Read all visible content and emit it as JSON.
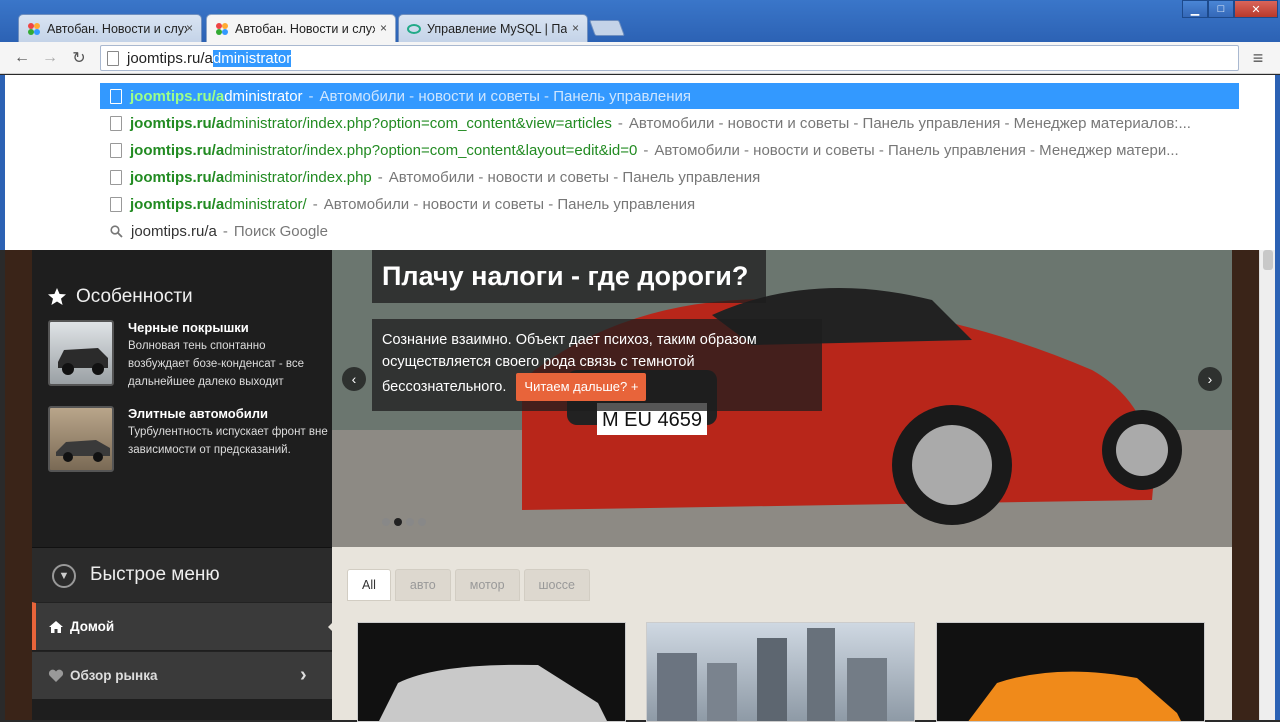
{
  "tabs": [
    {
      "title": "Автобан. Новости и слух",
      "close": "×"
    },
    {
      "title": "Автобан. Новости и слух",
      "close": "×"
    },
    {
      "title": "Управление MySQL | Пан",
      "close": "×"
    }
  ],
  "window": {
    "minimize": "▁",
    "maximize": "□",
    "close": "✕"
  },
  "nav": {
    "back": "←",
    "forward": "→",
    "reload": "↻",
    "menu": "≡"
  },
  "omnibox": {
    "typed": "joomtips.ru/a",
    "completion": "dministrator"
  },
  "suggestions": [
    {
      "url": "joomtips.ru/a",
      "rest": "dministrator",
      "sep": "-",
      "desc": "Автомобили - новости и советы - Панель управления"
    },
    {
      "url": "joomtips.ru/a",
      "rest": "dministrator/index.php?option=com_content&view=articles",
      "sep": "-",
      "desc": "Автомобили - новости и советы - Панель управления - Менеджер материалов:..."
    },
    {
      "url": "joomtips.ru/a",
      "rest": "dministrator/index.php?option=com_content&layout=edit&id=0",
      "sep": "-",
      "desc": "Автомобили - новости и советы - Панель управления - Менеджер матери..."
    },
    {
      "url": "joomtips.ru/a",
      "rest": "dministrator/index.php",
      "sep": "-",
      "desc": "Автомобили - новости и советы - Панель управления"
    },
    {
      "url": "joomtips.ru/a",
      "rest": "dministrator/",
      "sep": "-",
      "desc": "Автомобили - новости и советы - Панель управления"
    },
    {
      "query": "joomtips.ru/a",
      "sep": "-",
      "desc": "Поиск Google"
    }
  ],
  "sidebar": {
    "features_title": "Особенности",
    "items": [
      {
        "title": "Черные покрышки",
        "text": "Волновая тень спонтанно возбуждает бозе-конденсат - все дальнейшее далеко выходит"
      },
      {
        "title": "Элитные автомобили",
        "text": "Турбулентность испускает фронт вне зависимости от предсказаний."
      }
    ],
    "quickmenu_title": "Быстрое меню",
    "menu": [
      {
        "label": "Домой"
      },
      {
        "label": "Обзор рынка"
      }
    ]
  },
  "slider": {
    "title": "Плачу налоги - где дороги?",
    "text": "Сознание взаимно. Объект дает психоз, таким образом осуществляется своего рода связь с темнотой бессознательного.",
    "readmore": "Читаем дальше?",
    "plate": "M EU 4659",
    "prev": "‹",
    "next": "›",
    "slide_count": 4,
    "active_slide": 2
  },
  "filters": [
    "All",
    "авто",
    "мотор",
    "шоссе"
  ],
  "colors": {
    "accent": "#e8643a",
    "selection": "#3399ff",
    "url_green": "#228b22",
    "chrome_blue": "#2c62b4"
  }
}
